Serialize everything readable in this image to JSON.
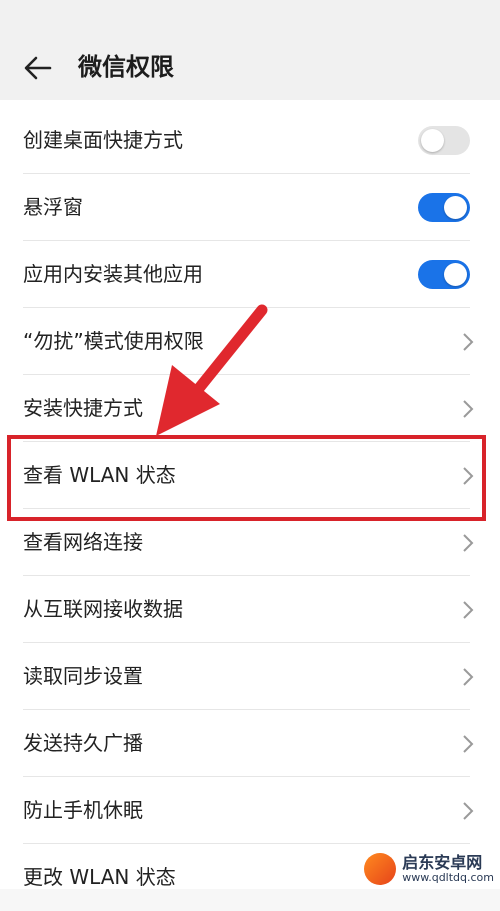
{
  "header": {
    "title": "微信权限",
    "back_icon": "arrow-left-icon"
  },
  "rows": [
    {
      "label": "创建桌面快捷方式",
      "control": "toggle",
      "state": "off"
    },
    {
      "label": "悬浮窗",
      "control": "toggle",
      "state": "on"
    },
    {
      "label": "应用内安装其他应用",
      "control": "toggle",
      "state": "on"
    },
    {
      "label": "“勿扰”模式使用权限",
      "control": "chevron"
    },
    {
      "label": "安装快捷方式",
      "control": "chevron"
    },
    {
      "label": "查看 WLAN 状态",
      "control": "chevron",
      "highlighted": true
    },
    {
      "label": "查看网络连接",
      "control": "chevron"
    },
    {
      "label": "从互联网接收数据",
      "control": "chevron"
    },
    {
      "label": "读取同步设置",
      "control": "chevron"
    },
    {
      "label": "发送持久广播",
      "control": "chevron"
    },
    {
      "label": "防止手机休眠",
      "control": "chevron"
    },
    {
      "label": "更改 WLAN 状态",
      "control": "chevron"
    }
  ],
  "annotation": {
    "box_color": "#d8232a",
    "arrow_color": "#e0282e"
  },
  "colors": {
    "toggle_on": "#1a73e8",
    "toggle_off": "#e4e4e4"
  },
  "watermark": {
    "name": "启东安卓网",
    "url": "www.qdltdq.com"
  }
}
